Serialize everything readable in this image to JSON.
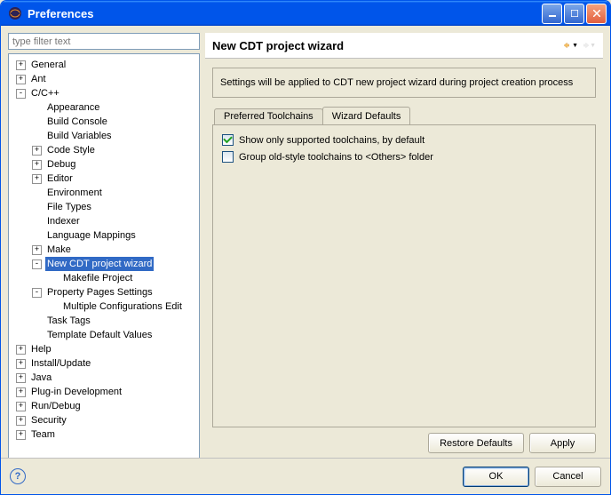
{
  "window": {
    "title": "Preferences"
  },
  "filter": {
    "placeholder": "type filter text"
  },
  "tree": [
    {
      "label": "General",
      "depth": 0,
      "exp": "+"
    },
    {
      "label": "Ant",
      "depth": 0,
      "exp": "+"
    },
    {
      "label": "C/C++",
      "depth": 0,
      "exp": "-"
    },
    {
      "label": "Appearance",
      "depth": 1,
      "exp": ""
    },
    {
      "label": "Build Console",
      "depth": 1,
      "exp": ""
    },
    {
      "label": "Build Variables",
      "depth": 1,
      "exp": ""
    },
    {
      "label": "Code Style",
      "depth": 1,
      "exp": "+"
    },
    {
      "label": "Debug",
      "depth": 1,
      "exp": "+"
    },
    {
      "label": "Editor",
      "depth": 1,
      "exp": "+"
    },
    {
      "label": "Environment",
      "depth": 1,
      "exp": ""
    },
    {
      "label": "File Types",
      "depth": 1,
      "exp": ""
    },
    {
      "label": "Indexer",
      "depth": 1,
      "exp": ""
    },
    {
      "label": "Language Mappings",
      "depth": 1,
      "exp": ""
    },
    {
      "label": "Make",
      "depth": 1,
      "exp": "+"
    },
    {
      "label": "New CDT project wizard",
      "depth": 1,
      "exp": "-",
      "selected": true
    },
    {
      "label": "Makefile Project",
      "depth": 2,
      "exp": ""
    },
    {
      "label": "Property Pages Settings",
      "depth": 1,
      "exp": "-"
    },
    {
      "label": "Multiple Configurations Edit",
      "depth": 2,
      "exp": ""
    },
    {
      "label": "Task Tags",
      "depth": 1,
      "exp": ""
    },
    {
      "label": "Template Default Values",
      "depth": 1,
      "exp": ""
    },
    {
      "label": "Help",
      "depth": 0,
      "exp": "+"
    },
    {
      "label": "Install/Update",
      "depth": 0,
      "exp": "+"
    },
    {
      "label": "Java",
      "depth": 0,
      "exp": "+"
    },
    {
      "label": "Plug-in Development",
      "depth": 0,
      "exp": "+"
    },
    {
      "label": "Run/Debug",
      "depth": 0,
      "exp": "+"
    },
    {
      "label": "Security",
      "depth": 0,
      "exp": "+"
    },
    {
      "label": "Team",
      "depth": 0,
      "exp": "+"
    }
  ],
  "page": {
    "title": "New CDT project wizard",
    "description": "Settings will be applied to CDT new project wizard during project creation process",
    "tabs": {
      "t0": "Preferred Toolchains",
      "t1": "Wizard Defaults"
    },
    "checkbox1": "Show only supported toolchains, by default",
    "checkbox2": "Group old-style toolchains to <Others> folder",
    "restore": "Restore Defaults",
    "apply": "Apply"
  },
  "footer": {
    "ok": "OK",
    "cancel": "Cancel",
    "help": "?"
  }
}
